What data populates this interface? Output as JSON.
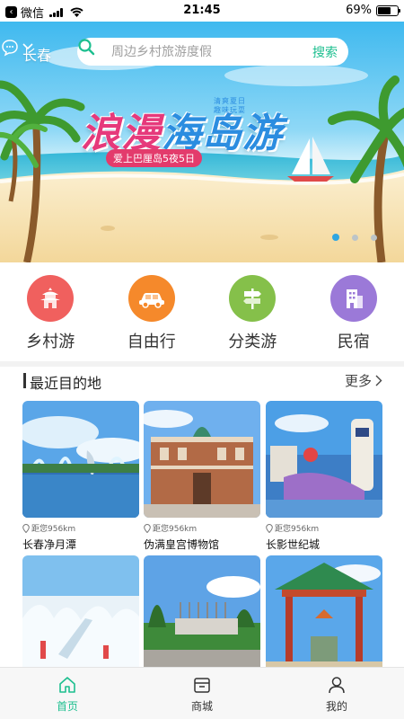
{
  "status_bar": {
    "carrier": "微信",
    "time": "21:45",
    "battery": "69%",
    "battery_level": 0.69
  },
  "header": {
    "city": "长春",
    "search_placeholder": "周边乡村旅游度假",
    "search_button": "搜索",
    "message_icon": "message-icon"
  },
  "banner": {
    "title_part1": "浪漫",
    "title_part2": "海岛游",
    "side_text_1": "清爽夏日",
    "side_text_2": "趣味玩耍",
    "subtitle": "爱上巴厘岛5夜5日",
    "slide_count": 3,
    "active_slide": 0
  },
  "categories": [
    {
      "label": "乡村游",
      "icon": "temple-icon",
      "color": "#f0605e"
    },
    {
      "label": "自由行",
      "icon": "car-icon",
      "color": "#f5892b"
    },
    {
      "label": "分类游",
      "icon": "signpost-icon",
      "color": "#85c04a"
    },
    {
      "label": "民宿",
      "icon": "building-icon",
      "color": "#9b79d8"
    }
  ],
  "section": {
    "title": "最近目的地",
    "more": "更多"
  },
  "destinations": [
    {
      "distance": "距您956km",
      "name": "长春净月潭"
    },
    {
      "distance": "距您956km",
      "name": "伪满皇宫博物馆"
    },
    {
      "distance": "距您956km",
      "name": "长影世纪城"
    },
    {
      "distance": "",
      "name": ""
    },
    {
      "distance": "",
      "name": ""
    },
    {
      "distance": "",
      "name": ""
    }
  ],
  "tabs": [
    {
      "label": "首页",
      "icon": "home-icon",
      "active": true
    },
    {
      "label": "商城",
      "icon": "shop-icon",
      "active": false
    },
    {
      "label": "我的",
      "icon": "user-icon",
      "active": false
    }
  ],
  "colors": {
    "accent": "#1dbf8f",
    "dot_active": "#2fa6e2"
  }
}
